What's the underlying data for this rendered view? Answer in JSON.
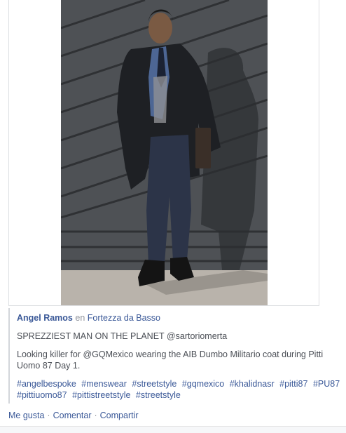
{
  "post": {
    "photo_alt": "Man in black coat and tie standing against striped wall",
    "author": "Angel Ramos",
    "connector": "en",
    "place": "Fortezza da Basso",
    "title_line": "SPREZZIEST MAN ON THE PLANET @sartoriomerta",
    "body_line": "Looking killer for @GQMexico wearing the AIB Dumbo Militario coat during Pitti Uomo 87 Day 1.",
    "hashtags": [
      "#angelbespoke",
      "#menswear",
      "#streetstyle",
      "#gqmexico",
      "#khalidnasr",
      "#pitti87",
      "#PU87",
      "#pittiuomo87",
      "#pittistreetstyle",
      "#streetstyle"
    ]
  },
  "actions": {
    "like": "Me gusta",
    "comment": "Comentar",
    "share": "Compartir",
    "separator": "·"
  },
  "colors": {
    "link": "#3b5998",
    "text": "#4b4f56",
    "muted": "#90949c"
  }
}
